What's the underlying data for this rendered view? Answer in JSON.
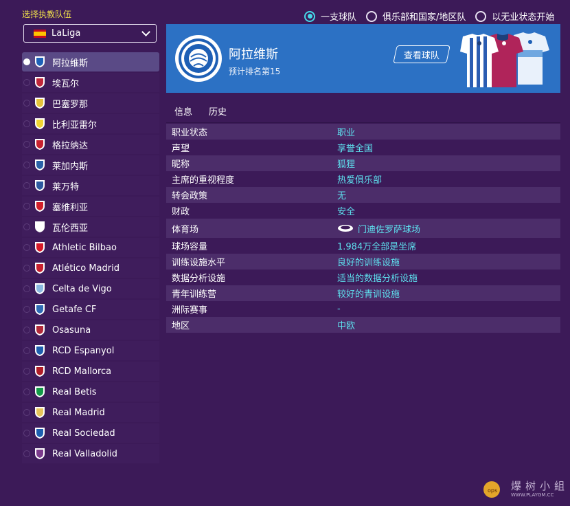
{
  "left_panel": {
    "title": "选择执教队伍",
    "league": "LaLiga",
    "teams": [
      {
        "name": "阿拉维斯",
        "color": "#1e62b8",
        "selected": true
      },
      {
        "name": "埃瓦尔",
        "color": "#c0273a"
      },
      {
        "name": "巴塞罗那",
        "color": "#e5c33b"
      },
      {
        "name": "比利亚雷尔",
        "color": "#f1d433"
      },
      {
        "name": "格拉纳达",
        "color": "#c8202f"
      },
      {
        "name": "莱加内斯",
        "color": "#2b62a8"
      },
      {
        "name": "莱万特",
        "color": "#2d5aa0"
      },
      {
        "name": "塞维利亚",
        "color": "#d21f2b"
      },
      {
        "name": "瓦伦西亚",
        "color": "#ffffff"
      },
      {
        "name": "Athletic Bilbao",
        "color": "#d71a28"
      },
      {
        "name": "Atlético Madrid",
        "color": "#c8202f"
      },
      {
        "name": "Celta de Vigo",
        "color": "#8ab8e0"
      },
      {
        "name": "Getafe CF",
        "color": "#2f6bb5"
      },
      {
        "name": "Osasuna",
        "color": "#b22a3a"
      },
      {
        "name": "RCD Espanyol",
        "color": "#1f5fae"
      },
      {
        "name": "RCD Mallorca",
        "color": "#b01e28"
      },
      {
        "name": "Real Betis",
        "color": "#139a48"
      },
      {
        "name": "Real Madrid",
        "color": "#e7c45a"
      },
      {
        "name": "Real Sociedad",
        "color": "#1d5fb0"
      },
      {
        "name": "Real Valladolid",
        "color": "#7b3b8c"
      }
    ]
  },
  "options": [
    {
      "label": "一支球队",
      "selected": true
    },
    {
      "label": "俱乐部和国家/地区队",
      "selected": false
    },
    {
      "label": "以无业状态开始",
      "selected": false
    }
  ],
  "club": {
    "name": "阿拉维斯",
    "rank_text": "预计排名第15",
    "view_button": "查看球队",
    "banner_color": "#2c71c4"
  },
  "tabs": [
    "信息",
    "历史"
  ],
  "info_rows": [
    {
      "k": "职业状态",
      "v": "职业"
    },
    {
      "k": "声望",
      "v": "享誉全国"
    },
    {
      "k": "昵称",
      "v": "狐狸"
    },
    {
      "k": "主席的重视程度",
      "v": "热爱俱乐部"
    },
    {
      "k": "转会政策",
      "v": "无"
    },
    {
      "k": "财政",
      "v": "安全"
    },
    {
      "k": "体育场",
      "v": "门迪佐罗萨球场",
      "icon": "stadium-icon"
    },
    {
      "k": "球场容量",
      "v": "1.984万全部是坐席"
    },
    {
      "k": "训练设施水平",
      "v": "良好的训练设施"
    },
    {
      "k": "数据分析设施",
      "v": "适当的数据分析设施"
    },
    {
      "k": "青年训练营",
      "v": "较好的青训设施"
    },
    {
      "k": "洲际赛事",
      "v": "-"
    },
    {
      "k": "地区",
      "v": "中欧"
    }
  ],
  "watermark": {
    "text": "爆树小組",
    "url": "WWW.PLAYGM.CC",
    "badge": "ops"
  }
}
